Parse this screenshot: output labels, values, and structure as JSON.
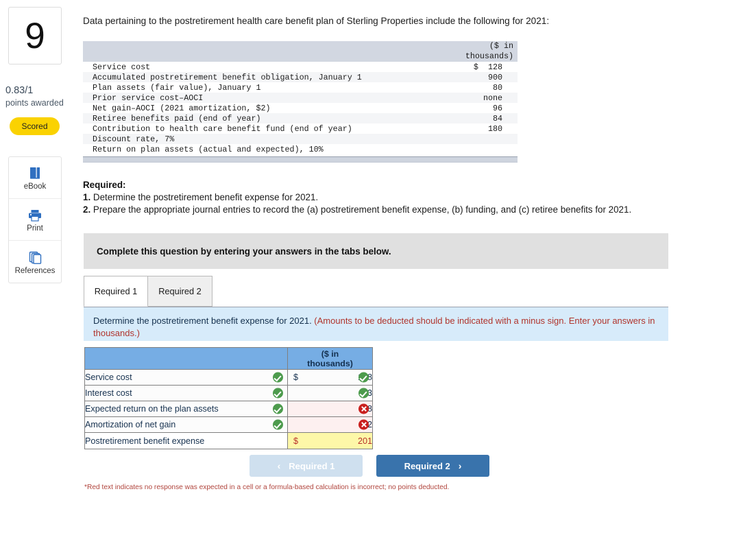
{
  "sidebar": {
    "question_number": "9",
    "points_awarded_value": "0.83/1",
    "points_awarded_label": "points awarded",
    "status_badge": "Scored",
    "tools": [
      {
        "icon": "ebook-icon",
        "label": "eBook"
      },
      {
        "icon": "printer-icon",
        "label": "Print"
      },
      {
        "icon": "references-copy-icon",
        "label": "References"
      }
    ]
  },
  "intro": "Data pertaining to the postretirement health care benefit plan of Sterling Properties include the following for 2021:",
  "data_table": {
    "header_amount": "($ in\nthousands)",
    "rows": [
      {
        "label": "Service cost",
        "value": "$  128"
      },
      {
        "label": "Accumulated postretirement benefit obligation, January 1",
        "value": "900"
      },
      {
        "label": "Plan assets (fair value), January 1",
        "value": "80"
      },
      {
        "label": "Prior service cost–AOCI",
        "value": "none"
      },
      {
        "label": "Net gain–AOCI (2021 amortization, $2)",
        "value": "96"
      },
      {
        "label": "Retiree benefits paid (end of year)",
        "value": "84"
      },
      {
        "label": "Contribution to health care benefit fund (end of year)",
        "value": "180"
      },
      {
        "label": "Discount rate, 7%",
        "value": ""
      },
      {
        "label": "Return on plan assets (actual and expected), 10%",
        "value": ""
      }
    ]
  },
  "required": {
    "heading": "Required:",
    "items": [
      {
        "num": "1.",
        "text": " Determine the postretirement benefit expense for 2021."
      },
      {
        "num": "2.",
        "text": " Prepare the appropriate journal entries to record the (a) postretirement benefit expense, (b) funding, and (c) retiree benefits for 2021."
      }
    ]
  },
  "instruction_banner": "Complete this question by entering your answers in the tabs below.",
  "tabs": [
    {
      "label": "Required 1",
      "active": true
    },
    {
      "label": "Required 2",
      "active": false
    }
  ],
  "blue_panel": {
    "black_text": "Determine the postretirement benefit expense for 2021. ",
    "red_text": "(Amounts to be deducted should be indicated with a minus sign. Enter your answers in thousands.)"
  },
  "answer_table": {
    "header_blank": "",
    "header_amount_line1": "($ in",
    "header_amount_line2": "thousands)",
    "rows": [
      {
        "label": "Service cost",
        "label_mark": "correct",
        "dollar": "$",
        "value": "128",
        "value_mark": "correct"
      },
      {
        "label": "Interest cost",
        "label_mark": "correct",
        "dollar": "",
        "value": "63",
        "value_mark": "correct"
      },
      {
        "label": "Expected return on the plan assets",
        "label_mark": "correct",
        "dollar": "",
        "value": "8",
        "value_mark": "incorrect"
      },
      {
        "label": "Amortization of net gain",
        "label_mark": "correct",
        "dollar": "",
        "value": "2",
        "value_mark": "incorrect"
      }
    ],
    "total": {
      "label": "Postretirement benefit expense",
      "dollar": "$",
      "value": "201"
    }
  },
  "nav": {
    "prev_label": "Required 1",
    "prev_chevron": "‹",
    "next_label": "Required 2",
    "next_chevron": "›"
  },
  "footnote": "*Red text indicates no response was expected in a cell or a formula-based calculation is incorrect; no points deducted.",
  "colors": {
    "badge_yellow": "#fad201",
    "answer_header_blue": "#76ade4",
    "blue_panel": "#d7ebfa",
    "gray_panel": "#e0e0e0",
    "total_yellow": "#fdf7a8",
    "red_text": "#b0342c",
    "correct_green": "#4d9b4d",
    "incorrect_red": "#c9201e",
    "next_button_blue": "#3973ac"
  }
}
